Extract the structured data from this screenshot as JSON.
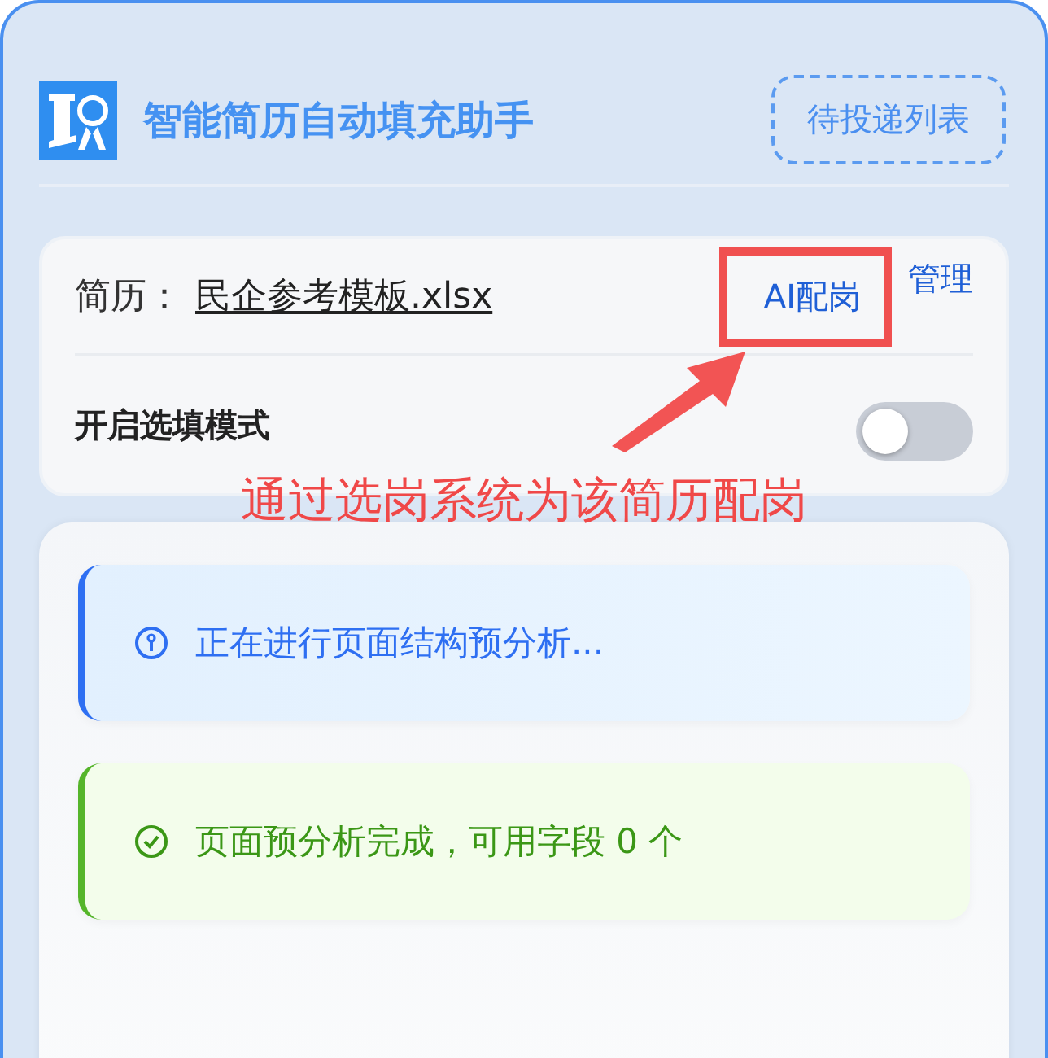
{
  "header": {
    "title": "智能简历自动填充助手",
    "pending_button": "待投递列表"
  },
  "resume": {
    "label": "简历：",
    "file": "民企参考模板.xlsx",
    "actions": [
      {
        "label": "AI配岗",
        "highlighted": true
      },
      {
        "label": "管理",
        "highlighted": false
      }
    ]
  },
  "option": {
    "label": "开启选填模式",
    "on": false
  },
  "alerts": [
    {
      "kind": "info",
      "text": "正在进行页面结构预分析..."
    },
    {
      "kind": "success",
      "text": "页面预分析完成，可用字段 0 个"
    }
  ],
  "annotation": {
    "text": "通过选岗系统为该简历配岗"
  }
}
